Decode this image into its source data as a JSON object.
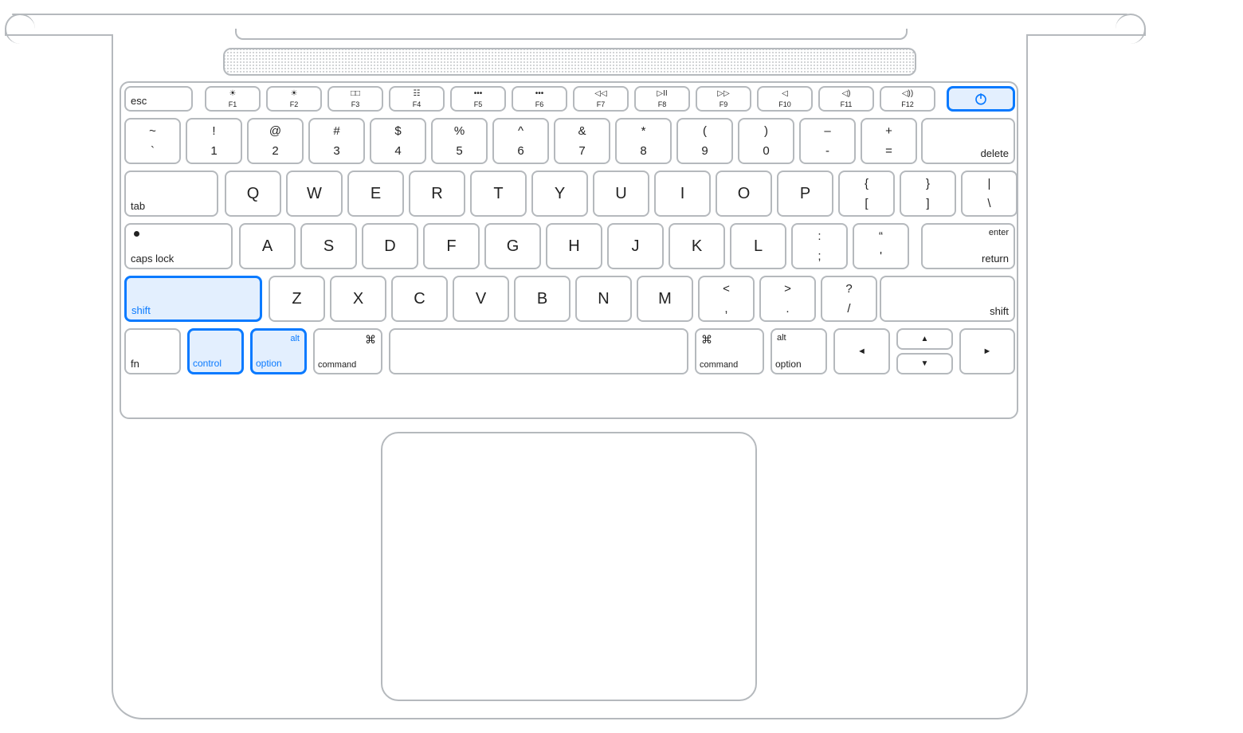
{
  "highlighted_keys": [
    "power",
    "left-shift",
    "left-control",
    "left-option"
  ],
  "function_row": {
    "esc": "esc",
    "keys": [
      {
        "label": "F1",
        "icon": "brightness-down"
      },
      {
        "label": "F2",
        "icon": "brightness-up"
      },
      {
        "label": "F3",
        "icon": "mission-control"
      },
      {
        "label": "F4",
        "icon": "launchpad"
      },
      {
        "label": "F5",
        "icon": "kb-bright-down"
      },
      {
        "label": "F6",
        "icon": "kb-bright-up"
      },
      {
        "label": "F7",
        "icon": "rewind"
      },
      {
        "label": "F8",
        "icon": "play-pause"
      },
      {
        "label": "F9",
        "icon": "fast-forward"
      },
      {
        "label": "F10",
        "icon": "mute"
      },
      {
        "label": "F11",
        "icon": "volume-down"
      },
      {
        "label": "F12",
        "icon": "volume-up"
      }
    ],
    "power_icon": "power"
  },
  "row1": {
    "keys": [
      {
        "top": "~",
        "bottom": "`"
      },
      {
        "top": "!",
        "bottom": "1"
      },
      {
        "top": "@",
        "bottom": "2"
      },
      {
        "top": "#",
        "bottom": "3"
      },
      {
        "top": "$",
        "bottom": "4"
      },
      {
        "top": "%",
        "bottom": "5"
      },
      {
        "top": "^",
        "bottom": "6"
      },
      {
        "top": "&",
        "bottom": "7"
      },
      {
        "top": "*",
        "bottom": "8"
      },
      {
        "top": "(",
        "bottom": "9"
      },
      {
        "top": ")",
        "bottom": "0"
      },
      {
        "top": "–",
        "bottom": "-"
      },
      {
        "top": "+",
        "bottom": "="
      }
    ],
    "delete": "delete"
  },
  "row2": {
    "tab": "tab",
    "letters": [
      "Q",
      "W",
      "E",
      "R",
      "T",
      "Y",
      "U",
      "I",
      "O",
      "P"
    ],
    "brackets": [
      {
        "top": "{",
        "bottom": "["
      },
      {
        "top": "}",
        "bottom": "]"
      },
      {
        "top": "|",
        "bottom": "\\"
      }
    ]
  },
  "row3": {
    "caps": "caps lock",
    "letters": [
      "A",
      "S",
      "D",
      "F",
      "G",
      "H",
      "J",
      "K",
      "L"
    ],
    "punct": [
      {
        "top": ":",
        "bottom": ";"
      },
      {
        "top": "“",
        "bottom": "'"
      }
    ],
    "return_top": "enter",
    "return_bottom": "return"
  },
  "row4": {
    "lshift": "shift",
    "letters": [
      "Z",
      "X",
      "C",
      "V",
      "B",
      "N",
      "M"
    ],
    "punct": [
      {
        "top": "<",
        "bottom": ","
      },
      {
        "top": ">",
        "bottom": "."
      },
      {
        "top": "?",
        "bottom": "/"
      }
    ],
    "rshift": "shift"
  },
  "row5": {
    "fn": "fn",
    "control": "control",
    "loption_alt": "alt",
    "loption": "option",
    "lcommand_sym": "⌘",
    "lcommand": "command",
    "rcommand_sym": "⌘",
    "rcommand": "command",
    "roption_alt": "alt",
    "roption": "option",
    "arrows": {
      "left": "◄",
      "up": "▲",
      "down": "▼",
      "right": "►"
    }
  },
  "fn_icons": {
    "brightness-down": "☀︎",
    "brightness-up": "☀︎",
    "mission-control": "□□",
    "launchpad": "☷",
    "kb-bright-down": "•••",
    "kb-bright-up": "•••",
    "rewind": "◁◁",
    "play-pause": "▷II",
    "fast-forward": "▷▷",
    "mute": "◁",
    "volume-down": "◁)",
    "volume-up": "◁))"
  }
}
